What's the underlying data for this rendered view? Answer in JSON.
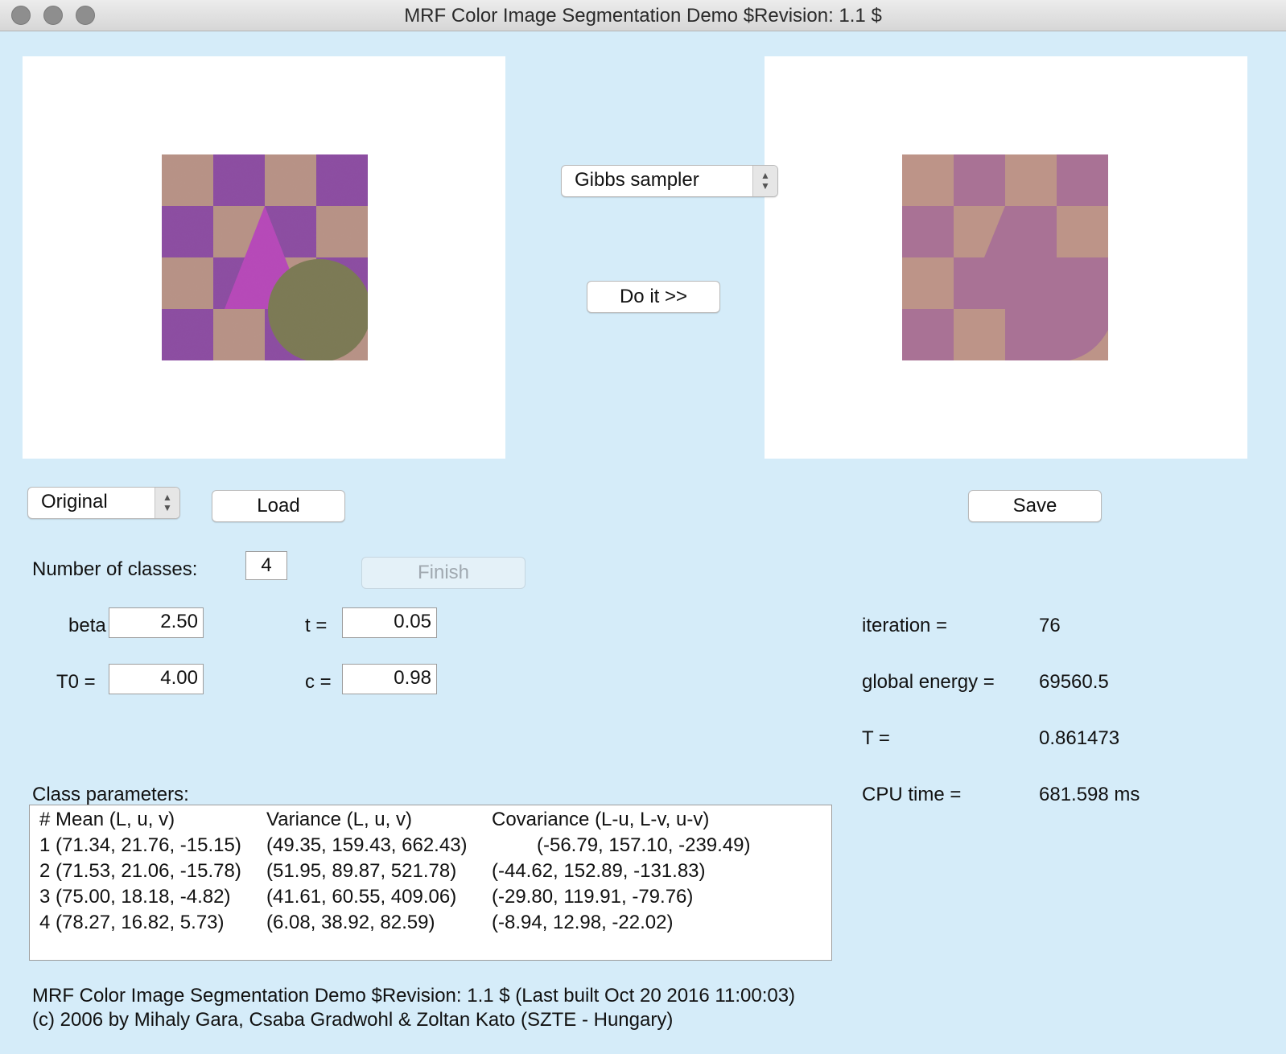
{
  "window": {
    "title": "MRF Color Image Segmentation Demo $Revision: 1.1 $"
  },
  "colors": {
    "background": "#d5ecf9",
    "orig_light": "#b79286",
    "orig_purple": "#8c4ea1",
    "orig_triangle": "#b64ab8",
    "orig_circle": "#7c7a55",
    "seg_light": "#bd9488",
    "seg_purple": "#a97295"
  },
  "method_select": {
    "value": "Gibbs sampler"
  },
  "doit_button": {
    "label": "Do it >>"
  },
  "view_select": {
    "value": "Original"
  },
  "load_button": {
    "label": "Load"
  },
  "save_button": {
    "label": "Save"
  },
  "classes": {
    "label": "Number of classes:",
    "value": "4"
  },
  "finish_button": {
    "label": "Finish"
  },
  "params": {
    "beta_label": "beta =",
    "beta_value": "2.50",
    "t_label": "t =",
    "t_value": "0.05",
    "t0_label": "T0 =",
    "t0_value": "4.00",
    "c_label": "c =",
    "c_value": "0.98"
  },
  "stats": {
    "iteration_label": "iteration =",
    "iteration_value": "76",
    "energy_label": "global energy =",
    "energy_value": "69560.5",
    "temp_label": "T =",
    "temp_value": "0.861473",
    "cpu_label": "CPU time =",
    "cpu_value": "681.598 ms"
  },
  "class_params": {
    "title": "Class parameters:",
    "header": {
      "mean": "# Mean (L, u, v)",
      "variance": "Variance (L, u, v)",
      "covariance": "Covariance (L-u, L-v, u-v)"
    },
    "rows": [
      {
        "mean": "1 (71.34, 21.76, -15.15)",
        "variance": "(49.35, 159.43, 662.43)",
        "covariance": "(-56.79, 157.10, -239.49)"
      },
      {
        "mean": "2 (71.53, 21.06, -15.78)",
        "variance": "(51.95, 89.87, 521.78)",
        "covariance": "(-44.62, 152.89, -131.83)"
      },
      {
        "mean": "3 (75.00, 18.18, -4.82)",
        "variance": "(41.61, 60.55, 409.06)",
        "covariance": "(-29.80, 119.91, -79.76)"
      },
      {
        "mean": "4 (78.27, 16.82, 5.73)",
        "variance": "(6.08, 38.92, 82.59)",
        "covariance": "(-8.94, 12.98, -22.02)"
      }
    ]
  },
  "footer": {
    "line1": "MRF Color Image Segmentation Demo $Revision: 1.1 $ (Last built Oct 20 2016 11:00:03)",
    "line2": "(c) 2006 by Mihaly Gara, Csaba Gradwohl & Zoltan Kato (SZTE - Hungary)"
  }
}
